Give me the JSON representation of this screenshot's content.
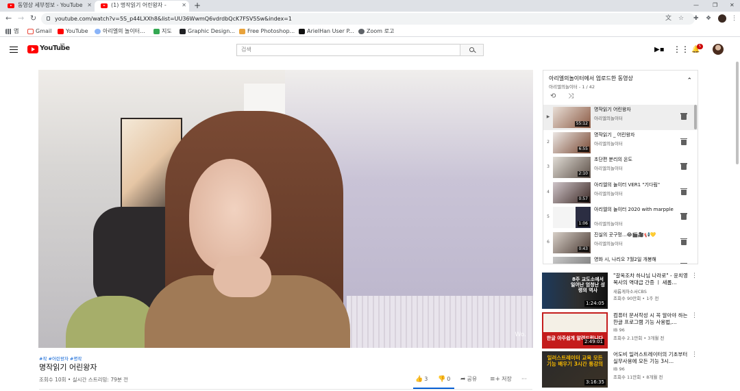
{
  "browser": {
    "tabs": [
      {
        "label": "동영상 세부정보 - YouTube",
        "active": false
      },
      {
        "label": "(1) 명작읽기 어린왕자 -",
        "active": true
      }
    ],
    "url": "youtube.com/watch?v=5S_p44LXXh8&list=UU36WwmQ6vdrdbQcK7FSV5Sw&index=1",
    "bookmarks": [
      {
        "label": "앱",
        "icon": "apps-grid-icon"
      },
      {
        "label": "Gmail",
        "icon": "gmail-icon"
      },
      {
        "label": "YouTube",
        "icon": "youtube-icon"
      },
      {
        "label": "아리엘의 놀이터...",
        "icon": "globe-icon"
      },
      {
        "label": "지도",
        "icon": "maps-icon"
      },
      {
        "label": "Graphic Design...",
        "icon": "bookmark-icon"
      },
      {
        "label": "Free Photoshop...",
        "icon": "photoshop-icon"
      },
      {
        "label": "ArielHan User P...",
        "icon": "user-page-icon"
      },
      {
        "label": "Zoom 로고",
        "icon": "globe-icon"
      }
    ]
  },
  "masthead": {
    "wordmark": "YouTube",
    "country": "KR",
    "search_placeholder": "검색",
    "notification_count": "5"
  },
  "video": {
    "hashtags": "#작 #어린왕자 #명작",
    "title": "명작읽기 어린왕자",
    "meta": "조회수 10회 • 실시간 스트리밍: 79분 전",
    "watermark": "Wo.",
    "actions": {
      "likes": "3",
      "dislikes": "0",
      "share": "공유",
      "save": "저장",
      "more": "···"
    }
  },
  "playlist": {
    "title": "아리엘의놀이터에서 업로드한 동영상",
    "subtitle": "아리엘의놀이터 - 1 / 42",
    "items": [
      {
        "idx": "▶",
        "title": "명작읽기 어린왕자",
        "channel": "아리엘의놀이터",
        "duration": "55:12",
        "now": true
      },
      {
        "idx": "2",
        "title": "명작읽기 _ 어린왕자",
        "channel": "아리엘의놀이터",
        "duration": "6:55",
        "now": false
      },
      {
        "idx": "3",
        "title": "초단편 분리의 온도",
        "channel": "아리엘의놀이터",
        "duration": "2:10",
        "now": false
      },
      {
        "idx": "4",
        "title": "아리엘의 놀이터 VER1 \"기다림\"",
        "channel": "아리엘의놀이터",
        "duration": "0:57",
        "now": false
      },
      {
        "idx": "5",
        "title": "아리엘의 놀이터 2020 with marpple",
        "channel": "아리엘의놀이터",
        "duration": "1:06",
        "now": false
      },
      {
        "idx": "6",
        "title": "진실의 곳구멍...😂🎬🎥📢💛",
        "channel": "아리엘의놀이터",
        "duration": "0:43",
        "now": false
      },
      {
        "idx": "7",
        "title": "영화 시, 나리오 7월2일 개봉해",
        "channel": "",
        "duration": "",
        "now": false
      }
    ]
  },
  "recommended": [
    {
      "title": "\"갈옥조차 하나님 나라로\" - 윤치영 목사의 역대급 간증 ㅣ 새롭...",
      "channel": "새롭게하소서CBS",
      "meta": "조회수 90만회 • 1주 전",
      "duration": "1:24:05",
      "thumb_text": "8주 교도소에서 일어난 엄청난 성령의 역사"
    },
    {
      "title": "컴퓨터 문서작성 시 꼭 알아야 하는 한글 프로그램 기능 사용법,...",
      "channel": "IB 96",
      "meta": "조회수 2.1만회 • 3개월 전",
      "duration": "2:49:01",
      "thumb_text": "한글 아주쉽게 알려드립니다"
    },
    {
      "title": "어도비 일러스트레이터의 기초부터 실무사용에 모든 기능 3시...",
      "channel": "IB 96",
      "meta": "조회수 11만회 • 8개월 전",
      "duration": "3:16:35",
      "thumb_text": "일러스트레이터 교육 모든기능 배우기 3시간 통강의"
    }
  ],
  "colors": {
    "youtube_red": "#ff0000",
    "link_blue": "#065fd4",
    "secondary_text": "#606060"
  }
}
